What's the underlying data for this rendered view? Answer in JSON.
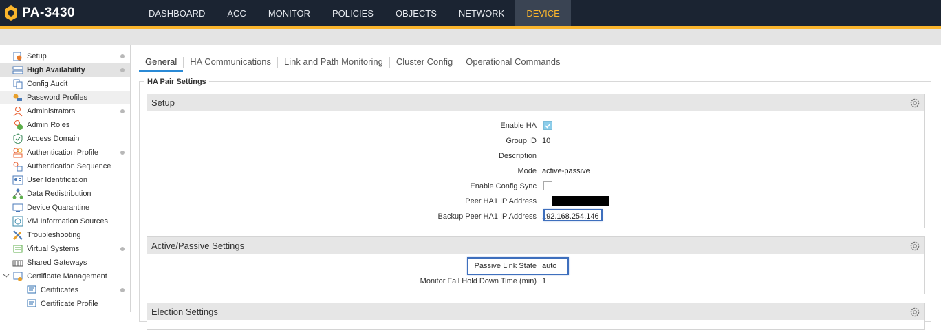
{
  "brand": {
    "name": "PA-3430",
    "accent_color": "#fab52c"
  },
  "nav": {
    "tabs": [
      {
        "label": "DASHBOARD",
        "active": false
      },
      {
        "label": "ACC",
        "active": false
      },
      {
        "label": "MONITOR",
        "active": false
      },
      {
        "label": "POLICIES",
        "active": false
      },
      {
        "label": "OBJECTS",
        "active": false
      },
      {
        "label": "NETWORK",
        "active": false
      },
      {
        "label": "DEVICE",
        "active": true
      }
    ]
  },
  "sidebar": {
    "items": [
      {
        "label": "Setup",
        "icon": "setup-icon",
        "dot": true
      },
      {
        "label": "High Availability",
        "icon": "high-availability-icon",
        "dot": true,
        "selected": true
      },
      {
        "label": "Config Audit",
        "icon": "config-audit-icon"
      },
      {
        "label": "Password Profiles",
        "icon": "password-profiles-icon",
        "hover": true
      },
      {
        "label": "Administrators",
        "icon": "administrators-icon",
        "dot": true
      },
      {
        "label": "Admin Roles",
        "icon": "admin-roles-icon"
      },
      {
        "label": "Access Domain",
        "icon": "access-domain-icon"
      },
      {
        "label": "Authentication Profile",
        "icon": "authentication-profile-icon",
        "dot": true
      },
      {
        "label": "Authentication Sequence",
        "icon": "authentication-sequence-icon"
      },
      {
        "label": "User Identification",
        "icon": "user-identification-icon"
      },
      {
        "label": "Data Redistribution",
        "icon": "data-redistribution-icon"
      },
      {
        "label": "Device Quarantine",
        "icon": "device-quarantine-icon"
      },
      {
        "label": "VM Information Sources",
        "icon": "vm-information-sources-icon"
      },
      {
        "label": "Troubleshooting",
        "icon": "troubleshooting-icon"
      },
      {
        "label": "Virtual Systems",
        "icon": "virtual-systems-icon",
        "dot": true
      },
      {
        "label": "Shared Gateways",
        "icon": "shared-gateways-icon"
      },
      {
        "label": "Certificate Management",
        "icon": "certificate-management-icon",
        "expanded": true
      },
      {
        "label": "Certificates",
        "icon": "certificates-icon",
        "dot": true,
        "indent": true
      },
      {
        "label": "Certificate Profile",
        "icon": "certificate-profile-icon",
        "indent": true
      }
    ]
  },
  "tabs": [
    {
      "label": "General",
      "active": true
    },
    {
      "label": "HA Communications",
      "active": false
    },
    {
      "label": "Link and Path Monitoring",
      "active": false
    },
    {
      "label": "Cluster Config",
      "active": false
    },
    {
      "label": "Operational Commands",
      "active": false
    }
  ],
  "group": {
    "legend": "HA Pair Settings"
  },
  "setup": {
    "title": "Setup",
    "enable_ha_label": "Enable HA",
    "enable_ha_checked": true,
    "group_id_label": "Group ID",
    "group_id_value": "10",
    "description_label": "Description",
    "description_value": "",
    "mode_label": "Mode",
    "mode_value": "active-passive",
    "enable_config_sync_label": "Enable Config Sync",
    "enable_config_sync_checked": false,
    "peer_ha1_label": "Peer HA1 IP Address",
    "backup_peer_ha1_label": "Backup Peer HA1 IP Address",
    "backup_peer_ha1_value": "192.168.254.146"
  },
  "active_passive": {
    "title": "Active/Passive Settings",
    "passive_link_state_label": "Passive Link State",
    "passive_link_state_value": "auto",
    "monitor_fail_label": "Monitor Fail Hold Down Time (min)",
    "monitor_fail_value": "1"
  },
  "election": {
    "title": "Election Settings"
  }
}
